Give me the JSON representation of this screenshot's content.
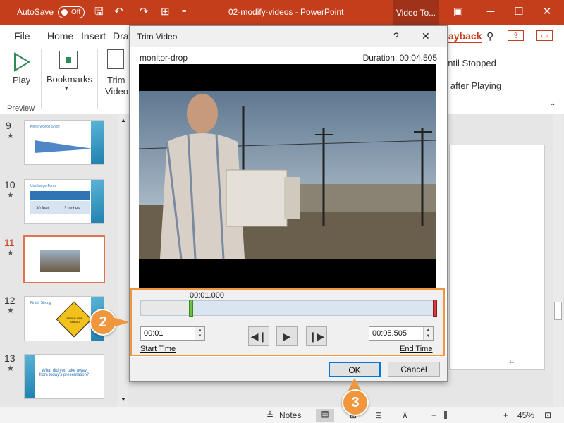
{
  "titlebar": {
    "autosave_label": "AutoSave",
    "autosave_state": "Off",
    "doc_title": "02-modify-videos  -  PowerPoint",
    "context_tab": "Video To..."
  },
  "menu": {
    "file": "File",
    "home": "Home",
    "insert": "Insert",
    "draw_partial": "Drav",
    "playback_partial": "ayback"
  },
  "ribbon": {
    "play": "Play",
    "bookmarks": "Bookmarks",
    "trim_video_1": "Trim",
    "trim_video_2": "Video",
    "preview_group": "Preview",
    "loop_partial": "until Stopped",
    "rewind_partial": "d after Playing"
  },
  "slides": [
    {
      "num": "9",
      "star": "★",
      "title": "Keep Videos Short"
    },
    {
      "num": "10",
      "star": "★",
      "title": "Use Large Fonts"
    },
    {
      "num": "11",
      "star": "★",
      "title": ""
    },
    {
      "num": "12",
      "star": "★",
      "title": "Finish Strong"
    },
    {
      "num": "13",
      "star": "★",
      "title": "What did you take away from today's presentation?"
    }
  ],
  "thumb_details": {
    "slide10_a": "30 feet",
    "slide10_b": "3 inches",
    "slide12_sign": "FINISH LINE AHEAD",
    "canvas_page": "11"
  },
  "status": {
    "notes": "Notes",
    "zoom_minus": "−",
    "zoom_plus": "+",
    "zoom_level": "45%"
  },
  "dialog": {
    "title": "Trim Video",
    "help": "?",
    "close": "✕",
    "video_name": "monitor-drop",
    "duration": "Duration: 00:04.505",
    "current_time": "00:01.000",
    "start_time_value": "00:01",
    "end_time_value": "00:05.505",
    "start_time_label": "Start Time",
    "end_time_label": "End Time",
    "ok": "OK",
    "cancel": "Cancel"
  },
  "callouts": {
    "step2": "2",
    "step3": "3"
  },
  "colors": {
    "accent": "#c43e1c",
    "callout": "#f0963c",
    "selected_slide": "#e3734f"
  }
}
